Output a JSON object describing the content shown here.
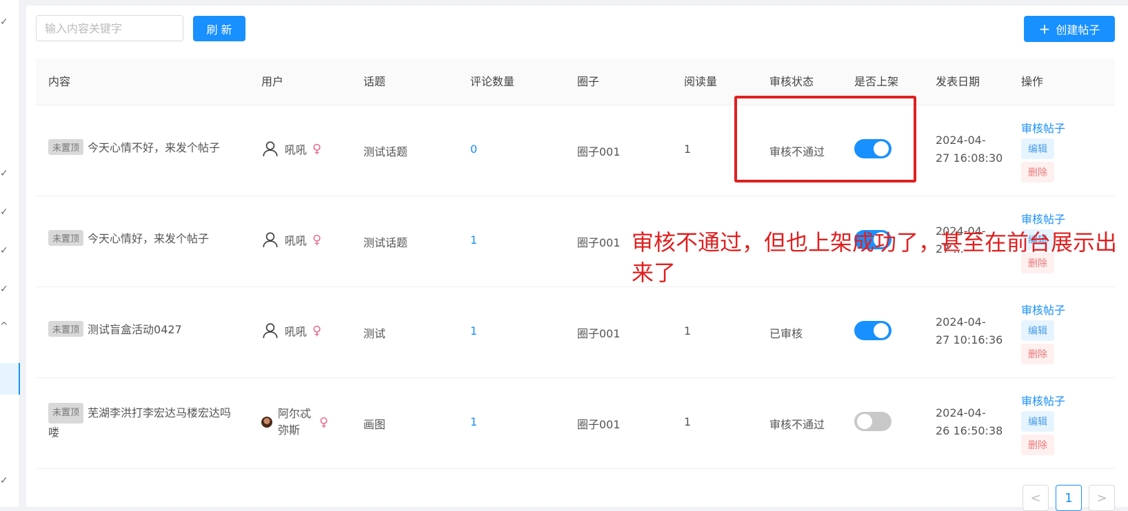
{
  "toolbar": {
    "search_placeholder": "输入内容关键字",
    "refresh_label": "刷 新",
    "create_label": "创建帖子",
    "create_icon": "plus-icon"
  },
  "table": {
    "headers": [
      "内容",
      "用户",
      "话题",
      "评论数量",
      "圈子",
      "阅读量",
      "审核状态",
      "是否上架",
      "发表日期",
      "操作"
    ],
    "rows": [
      {
        "pin": "未置顶",
        "content": "今天心情不好，来发个帖子",
        "user": "吼吼",
        "gender": "♀",
        "topic": "测试话题",
        "comments": "0",
        "circle": "圈子001",
        "reads": "1",
        "status": "审核不通过",
        "listed": true,
        "date1": "2024-04-",
        "date2": "27 16:08:30"
      },
      {
        "pin": "未置顶",
        "content": "今天心情好，来发个帖子",
        "user": "吼吼",
        "gender": "♀",
        "topic": "测试话题",
        "comments": "1",
        "circle": "圈子001",
        "reads": "",
        "status": "",
        "listed": true,
        "date1": "2024-04-",
        "date2": "27 ..."
      },
      {
        "pin": "未置顶",
        "content": "测试盲盒活动0427",
        "user": "吼吼",
        "gender": "♀",
        "topic": "测试",
        "comments": "1",
        "circle": "圈子001",
        "reads": "1",
        "status": "已审核",
        "listed": true,
        "date1": "2024-04-",
        "date2": "27 10:16:36"
      },
      {
        "pin": "未置顶",
        "content": "芜湖李洪打李宏达马楼宏达吗喽",
        "user": "阿尔忒弥斯",
        "gender": "♀",
        "topic": "画图",
        "comments": "1",
        "circle": "圈子001",
        "reads": "1",
        "status": "审核不通过",
        "listed": false,
        "date1": "2024-04-",
        "date2": "26 16:50:38"
      }
    ],
    "actions": {
      "review": "审核帖子",
      "edit": "编辑",
      "delete": "删除"
    }
  },
  "annotation": {
    "text": "审核不通过，但也上架成功了，甚至在前台展示出来了",
    "color": "#e02020"
  },
  "pagination": {
    "prev": "<",
    "current": "1",
    "next": ">"
  },
  "colors": {
    "primary": "#1890ff",
    "female": "#e86b8e",
    "annotation_red": "#e02020"
  }
}
